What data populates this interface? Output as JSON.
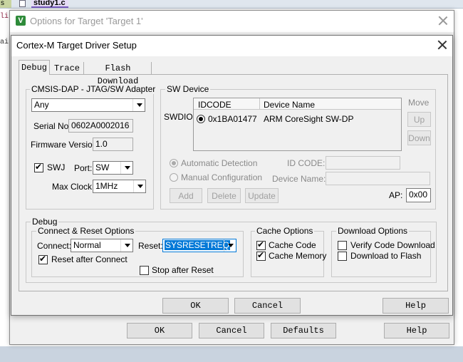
{
  "editor": {
    "tab_left": "s",
    "tab_file": "study1.c",
    "side_text_1": "li",
    "side_text_2": "ai"
  },
  "outer_dialog": {
    "title": "Options for Target 'Target 1'",
    "ok": "OK",
    "cancel": "Cancel",
    "defaults": "Defaults",
    "help": "Help"
  },
  "dialog": {
    "title": "Cortex-M Target Driver Setup",
    "tabs": [
      "Debug",
      "Trace",
      "Flash Download"
    ],
    "adapter": {
      "group": "CMSIS-DAP - JTAG/SW Adapter",
      "adapter_value": "Any",
      "serial_label": "Serial No:",
      "serial_value": "0602A0002016",
      "firmware_label": "Firmware Version:",
      "firmware_value": "1.0",
      "swj_label": "SWJ",
      "port_label": "Port:",
      "port_value": "SW",
      "clock_label": "Max Clock:",
      "clock_value": "1MHz"
    },
    "sw_device": {
      "group": "SW Device",
      "swdio_label": "SWDIO",
      "col_idcode": "IDCODE",
      "col_device": "Device Name",
      "row_idcode": "0x1BA01477",
      "row_device": "ARM CoreSight SW-DP",
      "move_label": "Move",
      "up": "Up",
      "down": "Down",
      "auto_detect": "Automatic Detection",
      "manual_config": "Manual Configuration",
      "id_code_label": "ID CODE:",
      "device_name_label": "Device Name:",
      "add": "Add",
      "delete": "Delete",
      "update": "Update",
      "ap_label": "AP:",
      "ap_value": "0x00"
    },
    "debug": {
      "group": "Debug",
      "connect_group": "Connect & Reset Options",
      "connect_label": "Connect:",
      "connect_value": "Normal",
      "reset_label": "Reset:",
      "reset_value": "SYSRESETREQ",
      "reset_after_connect": "Reset after Connect",
      "stop_after_reset": "Stop after Reset",
      "cache_group": "Cache Options",
      "cache_code": "Cache Code",
      "cache_memory": "Cache Memory",
      "download_group": "Download Options",
      "verify_download": "Verify Code Download",
      "download_to_flash": "Download to Flash"
    },
    "ok": "OK",
    "cancel": "Cancel",
    "help": "Help"
  }
}
